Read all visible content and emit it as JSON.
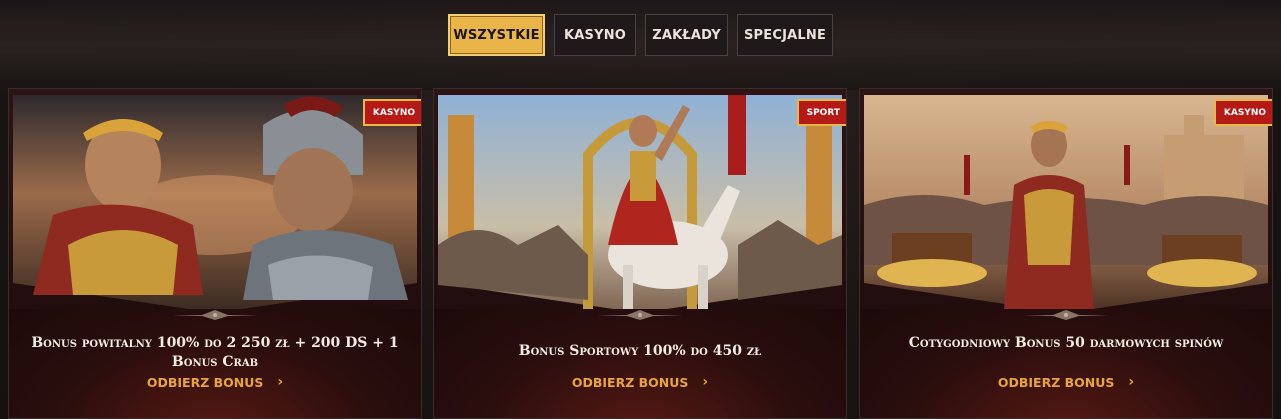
{
  "tabs": [
    {
      "label": "WSZYSTKIE",
      "active": true
    },
    {
      "label": "KASYNO",
      "active": false
    },
    {
      "label": "ZAKŁADY",
      "active": false
    },
    {
      "label": "SPECJALNE",
      "active": false
    }
  ],
  "cards": [
    {
      "badge": "KASYNO",
      "title": "Bonus powitalny 100% do 2 250 zł + 200 DS + 1 Bonus Crab",
      "cta": "ODBIERZ BONUS",
      "cta_icon": "chevron-right-icon"
    },
    {
      "badge": "SPORT",
      "title": "Bonus Sportowy 100% do 450 zł",
      "cta": "ODBIERZ BONUS",
      "cta_icon": "chevron-right-icon"
    },
    {
      "badge": "KASYNO",
      "title": "Cotygodniowy Bonus 50 darmowych spinów",
      "cta": "ODBIERZ BONUS",
      "cta_icon": "chevron-right-icon"
    }
  ],
  "colors": {
    "accent": "#e9b548",
    "badge_red": "#b51a17",
    "cta": "#e8a53a"
  }
}
